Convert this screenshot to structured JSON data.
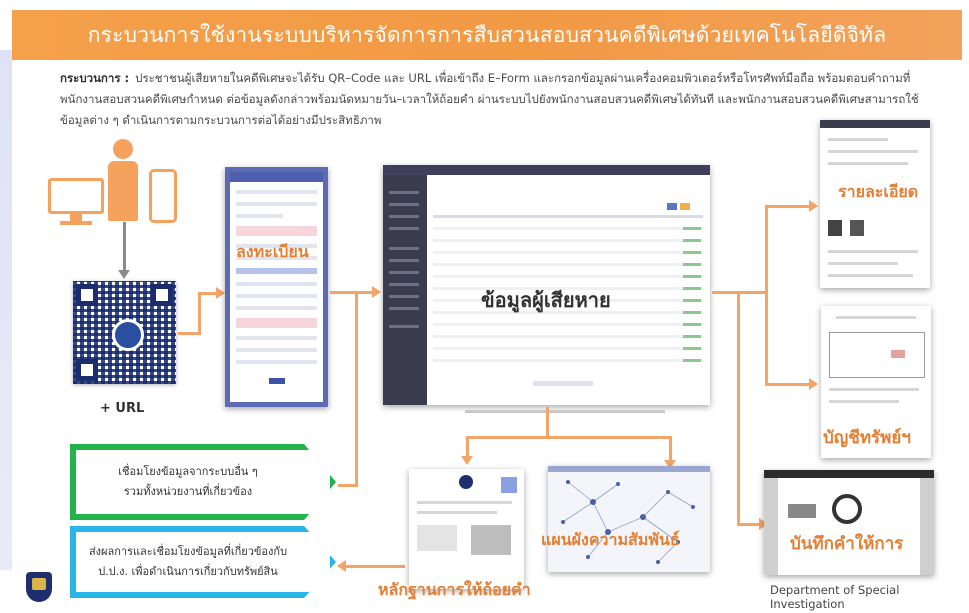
{
  "banner": {
    "title": "กระบวนการใช้งานระบบบริหารจัดการการสืบสวนสอบสวนคดีพิเศษด้วยเทคโนโลยีดิจิทัล"
  },
  "description": {
    "heading": "กระบวนการ :",
    "body": "ประชาชนผู้เสียหายในคดีพิเศษจะได้รับ QR–Code และ URL เพื่อเข้าถึง E–Form และกรอกข้อมูลผ่านเครื่องคอมพิวเตอร์หรือโทรศัพท์มือถือ พร้อมตอบคำถามที่พนักงานสอบสวนคดีพิเศษกำหนด ต่อข้อมูลดังกล่าวพร้อมนัดหมายวัน–เวลาให้ถ้อยคำ ผ่านระบบไปยังพนักงานสอบสวนคดีพิเศษได้ทันที และพนักงานสอบสวนคดีพิเศษสามารถใช้ข้อมูลต่าง ๆ ดำเนินการตามกระบวนการต่อได้อย่างมีประสิทธิภาพ"
  },
  "nodes": {
    "qr_suffix": "+ URL",
    "register": "ลงทะเบียน",
    "victim_data": "ข้อมูลผู้เสียหาย",
    "details": "รายละเอียด",
    "asset_list": "บัญชีทรัพย์ฯ",
    "testimony_record": "บันทึกคำให้การ",
    "evidence": "หลักฐานการให้ถ้อยคำ",
    "relationship_map": "แผนผังความสัมพันธ์"
  },
  "callouts": {
    "green": [
      "เชื่อมโยงข้อมูลจากระบบอื่น ๆ",
      "รวมทั้งหน่วยงานที่เกี่ยวข้อง"
    ],
    "blue": [
      "ส่งผลการและเชื่อมโยงข้อมูลที่เกี่ยวข้องกับ",
      "ป.ป.ง. เพื่อดำเนินการเกี่ยวกับทรัพย์สิน"
    ]
  },
  "footer": {
    "department": "Department of Special Investigation"
  },
  "colors": {
    "banner": "#f29944",
    "accent_orange": "#e27f35",
    "arrow": "#f4a466",
    "green_callout": "#24b24b",
    "blue_callout": "#29b5e8",
    "form_border": "#5d6bb5"
  },
  "icons": [
    "computer-monitor-icon",
    "person-icon",
    "mobile-phone-icon",
    "qr-code-icon",
    "dsi-seal-icon"
  ]
}
